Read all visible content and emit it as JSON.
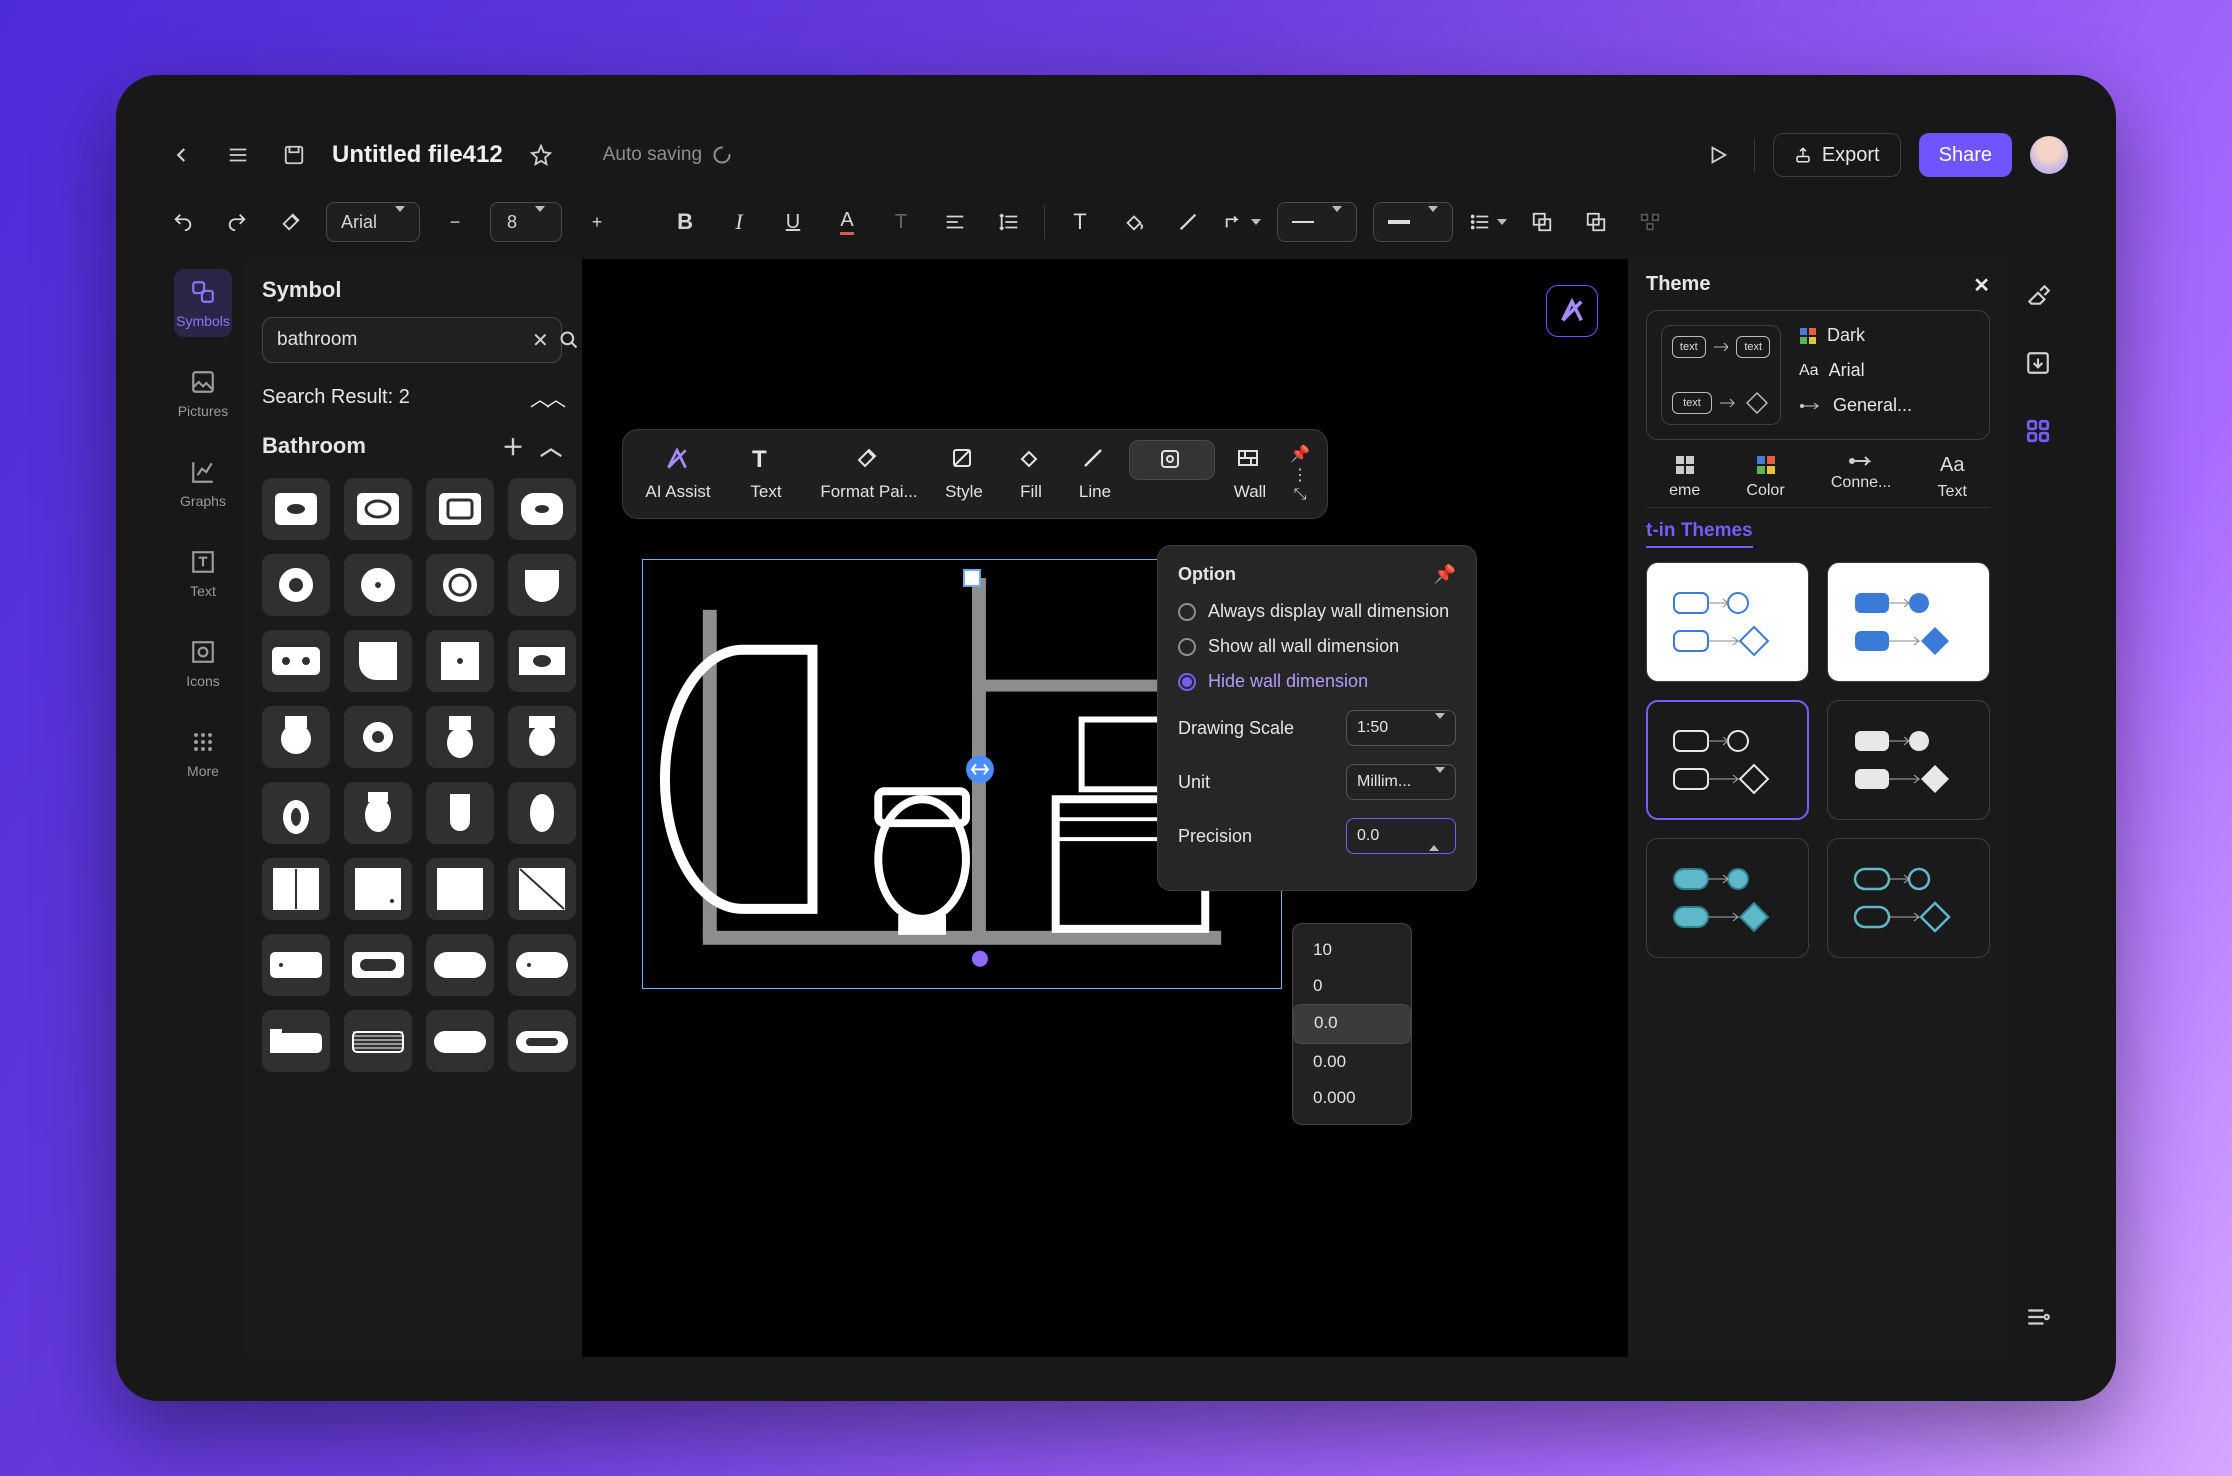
{
  "header": {
    "filename": "Untitled file412",
    "auto_save": "Auto saving",
    "export": "Export",
    "share": "Share"
  },
  "toolbar": {
    "font": "Arial",
    "font_size": "8"
  },
  "rail": {
    "symbols": "Symbols",
    "pictures": "Pictures",
    "graphs": "Graphs",
    "text": "Text",
    "icons": "Icons",
    "more": "More"
  },
  "panel": {
    "title": "Symbol",
    "search_value": "bathroom",
    "result_label": "Search Result: 2",
    "category": "Bathroom"
  },
  "float": {
    "ai": "AI Assist",
    "text": "Text",
    "format": "Format Pai...",
    "style": "Style",
    "fill": "Fill",
    "line": "Line",
    "option": "Option",
    "wall": "Wall"
  },
  "option_pop": {
    "title": "Option",
    "r1": "Always display wall dimension",
    "r2": "Show all wall dimension",
    "r3": "Hide wall dimension",
    "scale_label": "Drawing Scale",
    "scale_value": "1:50",
    "unit_label": "Unit",
    "unit_value": "Millim...",
    "precision_label": "Precision",
    "precision_value": "0.0",
    "opts": [
      "10",
      "0",
      "0.0",
      "0.00",
      "0.000"
    ]
  },
  "theme": {
    "title": "Theme",
    "dark": "Dark",
    "font": "Arial",
    "connector": "General...",
    "tab_theme": "eme",
    "tab_color": "Color",
    "tab_conn": "Conne...",
    "tab_text": "Text",
    "builtin": "t-in Themes"
  }
}
